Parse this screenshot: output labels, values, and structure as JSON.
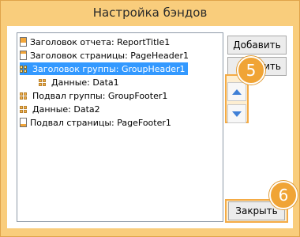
{
  "window": {
    "title": "Настройка бэндов"
  },
  "bands": [
    {
      "label": "Заголовок отчета: ReportTitle1",
      "icon": "report-title-band-icon",
      "selected": false,
      "indent": 0
    },
    {
      "label": "Заголовок страницы: PageHeader1",
      "icon": "page-header-band-icon",
      "selected": false,
      "indent": 0
    },
    {
      "label": "Заголовок группы: GroupHeader1",
      "icon": "group-header-band-icon",
      "selected": true,
      "indent": 0
    },
    {
      "label": "Данные: Data1",
      "icon": "data-band-icon",
      "selected": false,
      "indent": 1
    },
    {
      "label": "Подвал группы: GroupFooter1",
      "icon": "group-footer-band-icon",
      "selected": false,
      "indent": 0
    },
    {
      "label": "Данные: Data2",
      "icon": "data-band-icon",
      "selected": false,
      "indent": 0
    },
    {
      "label": "Подвал страницы: PageFooter1",
      "icon": "page-footer-band-icon",
      "selected": false,
      "indent": 0
    }
  ],
  "buttons": {
    "add": "Добавить",
    "delete_visible": "...ить",
    "close": "Закрыть"
  },
  "callouts": {
    "move": "5",
    "close": "6"
  },
  "colors": {
    "accent": "#f0a436",
    "selection": "#3399ff",
    "arrow": "#3e7fd6"
  }
}
